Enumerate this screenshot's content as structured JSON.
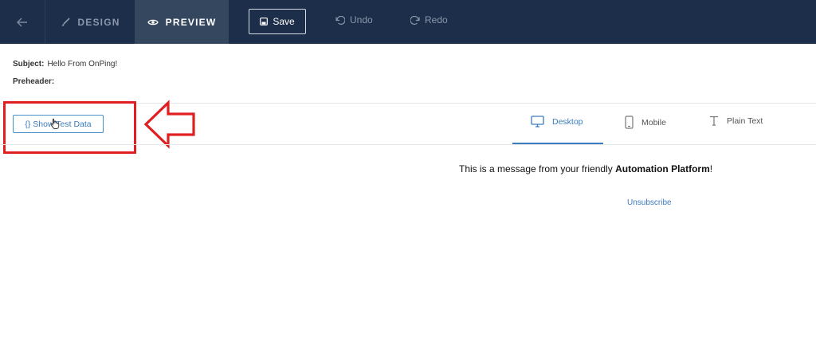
{
  "toolbar": {
    "back_icon": "arrow-left-icon",
    "design_label": "DESIGN",
    "preview_label": "PREVIEW",
    "save_label": "Save",
    "undo_label": "Undo",
    "redo_label": "Redo"
  },
  "email_meta": {
    "subject_label": "Subject:",
    "subject_value": "Hello From OnPing!",
    "preheader_label": "Preheader:",
    "preheader_value": ""
  },
  "test_data": {
    "button_label": "{} Show Test Data"
  },
  "view_tabs": [
    {
      "label": "Desktop",
      "icon": "desktop-icon",
      "active": true
    },
    {
      "label": "Mobile",
      "icon": "mobile-icon",
      "active": false
    },
    {
      "label": "Plain Text",
      "icon": "text-icon",
      "active": false
    }
  ],
  "preview": {
    "message_prefix": "This is a message from your friendly ",
    "message_bold": "Automation Platform",
    "message_suffix": "!",
    "unsubscribe_label": "Unsubscribe"
  },
  "colors": {
    "topbar": "#1c2e4a",
    "active_tab": "#34475f",
    "accent": "#3a7cbf",
    "annotation": "#e02020"
  }
}
